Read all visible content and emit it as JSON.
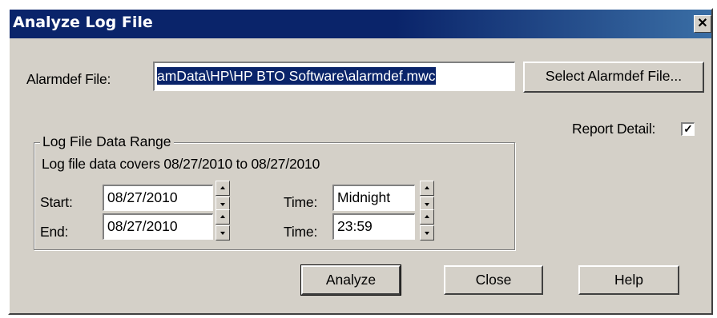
{
  "window": {
    "title": "Analyze Log File",
    "close_glyph": "✕"
  },
  "alarmdef": {
    "label": "Alarmdef File:",
    "value": "amData\\HP\\HP BTO Software\\alarmdef.mwc",
    "select_button": "Select Alarmdef File..."
  },
  "report_detail": {
    "label": "Report Detail:",
    "checked": true,
    "check_glyph": "✓"
  },
  "range": {
    "group_title": "Log File Data Range",
    "covers_text": "Log file data covers 08/27/2010 to 08/27/2010",
    "start_label": "Start:",
    "start_date": "08/27/2010",
    "start_time_label": "Time:",
    "start_time": "Midnight",
    "end_label": "End:",
    "end_date": "08/27/2010",
    "end_time_label": "Time:",
    "end_time": "23:59"
  },
  "buttons": {
    "analyze": "Analyze",
    "close": "Close",
    "help": "Help"
  }
}
